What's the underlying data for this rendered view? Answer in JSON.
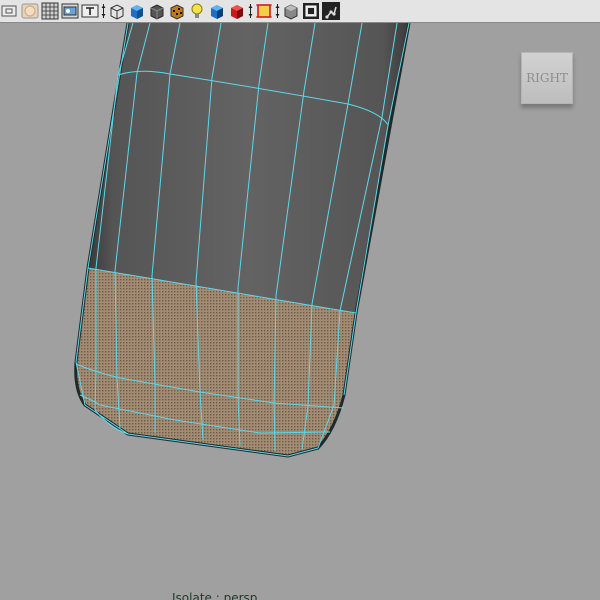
{
  "toolbar": {
    "buttons": [
      {
        "name": "select-camera-icon",
        "type": "button"
      },
      {
        "name": "image-plane-icon",
        "type": "button"
      },
      {
        "name": "grid-toggle-icon",
        "type": "button"
      },
      {
        "name": "film-gate-icon",
        "type": "button"
      },
      {
        "name": "resolution-gate-icon",
        "type": "button"
      },
      {
        "name": "separator",
        "type": "separator"
      },
      {
        "name": "wireframe-icon",
        "type": "button"
      },
      {
        "name": "smooth-shade-icon",
        "type": "button"
      },
      {
        "name": "wireframe-on-shaded-icon",
        "type": "button"
      },
      {
        "name": "textured-icon",
        "type": "button"
      },
      {
        "name": "use-all-lights-icon",
        "type": "button"
      },
      {
        "name": "shadows-icon",
        "type": "button"
      },
      {
        "name": "xray-icon",
        "type": "button"
      },
      {
        "name": "separator",
        "type": "separator"
      },
      {
        "name": "isolate-select-icon",
        "type": "button"
      },
      {
        "name": "separator",
        "type": "separator"
      },
      {
        "name": "xray-joints-icon",
        "type": "button"
      },
      {
        "name": "frame-all-icon",
        "type": "button"
      },
      {
        "name": "skeleton-icon",
        "type": "button"
      }
    ]
  },
  "viewcube": {
    "label": "RIGHT"
  },
  "hud": {
    "isolate_text": "Isolate : persp"
  },
  "colors": {
    "viewport_bg": "#a0a0a0",
    "mesh_body": "#606060",
    "wire_selected": "#5fd8e8",
    "selected_faces": "#9a8670"
  }
}
